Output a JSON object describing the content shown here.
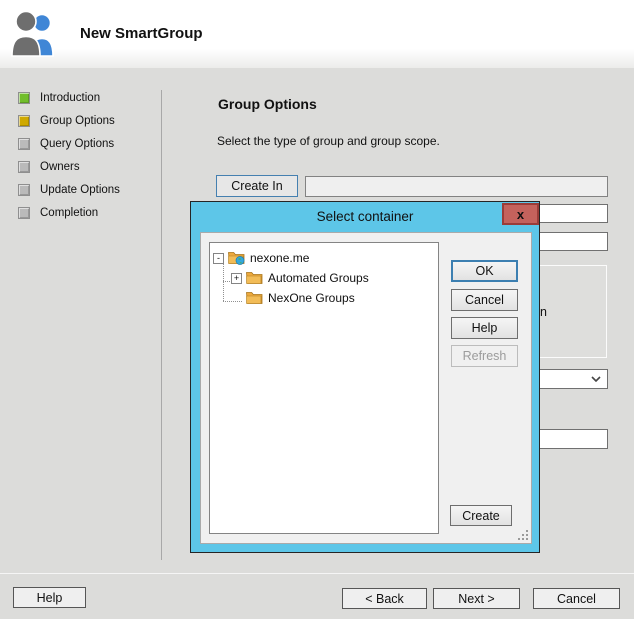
{
  "header": {
    "title": "New SmartGroup",
    "icon": "people-icon"
  },
  "sidebar": {
    "items": [
      {
        "label": "Introduction",
        "status": "complete",
        "color": "#71BE2B"
      },
      {
        "label": "Group Options",
        "status": "current",
        "color": "#CFA900"
      },
      {
        "label": "Query Options",
        "status": "pending",
        "color": "#BABABA"
      },
      {
        "label": "Owners",
        "status": "pending",
        "color": "#BABABA"
      },
      {
        "label": "Update Options",
        "status": "pending",
        "color": "#BABABA"
      },
      {
        "label": "Completion",
        "status": "pending",
        "color": "#BABABA"
      }
    ]
  },
  "main": {
    "heading": "Group Options",
    "subtitle": "Select the type of group and group scope.",
    "create_in_button": "Create In",
    "create_in_value": "",
    "obscured_text_fragment": "n"
  },
  "dialog": {
    "title": "Select container",
    "close_button": "x",
    "tree": {
      "items": [
        {
          "label": "nexone.me",
          "depth": 0,
          "expander": "-",
          "icon": "domain-folder-icon"
        },
        {
          "label": "Automated Groups",
          "depth": 1,
          "expander": "+",
          "icon": "folder-icon"
        },
        {
          "label": "NexOne Groups",
          "depth": 1,
          "expander": "",
          "icon": "folder-icon"
        }
      ]
    },
    "buttons": {
      "ok": "OK",
      "cancel": "Cancel",
      "help": "Help",
      "refresh": "Refresh",
      "create": "Create"
    },
    "refresh_disabled": true
  },
  "footer": {
    "help_button": "Help",
    "back_button": "< Back",
    "next_button": "Next >",
    "cancel_button": "Cancel"
  },
  "colors": {
    "titlebar_blue": "#5DC6E8",
    "close_red": "#C4625C",
    "default_button_border": "#3C7FB1",
    "status_complete": "#71BE2B",
    "status_current": "#CFA900",
    "status_pending": "#BABABA",
    "background_gray": "#DCDCDA"
  }
}
